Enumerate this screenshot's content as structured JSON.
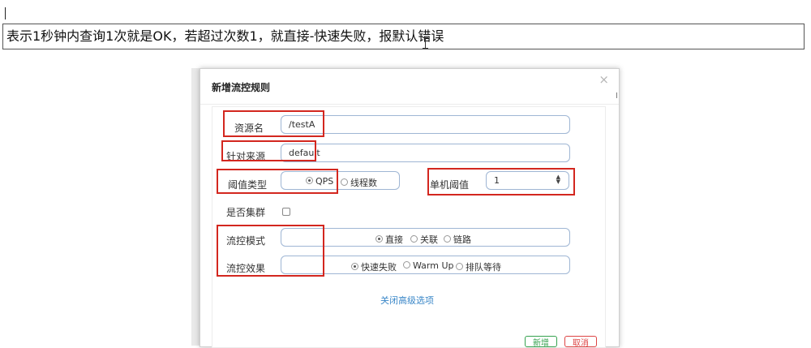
{
  "note": {
    "text": "表示1秒钟内查询1次就是OK，若超过次数1，就直接-快速失败，报默认错误"
  },
  "dialog": {
    "title": "新增流控规则",
    "close_glyph": "×",
    "close_under": "I",
    "resource": {
      "label": "资源名",
      "value": "/testA"
    },
    "limit_app": {
      "label": "针对来源",
      "value": "default"
    },
    "threshold_type": {
      "label": "阈值类型",
      "options": [
        "QPS",
        "线程数"
      ],
      "selected": "QPS"
    },
    "single_threshold": {
      "label": "单机阈值",
      "value": "1"
    },
    "cluster": {
      "label": "是否集群",
      "checked": false
    },
    "flow_mode": {
      "label": "流控模式",
      "options": [
        "直接",
        "关联",
        "链路"
      ],
      "selected": "直接"
    },
    "flow_effect": {
      "label": "流控效果",
      "options": [
        "快速失败",
        "Warm Up",
        "排队等待"
      ],
      "selected": "快速失败"
    },
    "advanced_link": "关闭高级选项",
    "save_label": "新增",
    "cancel_label": "取消"
  },
  "colors": {
    "highlight": "#d3271f",
    "link": "#3a87c8",
    "input_border": "#9fb6d4"
  }
}
